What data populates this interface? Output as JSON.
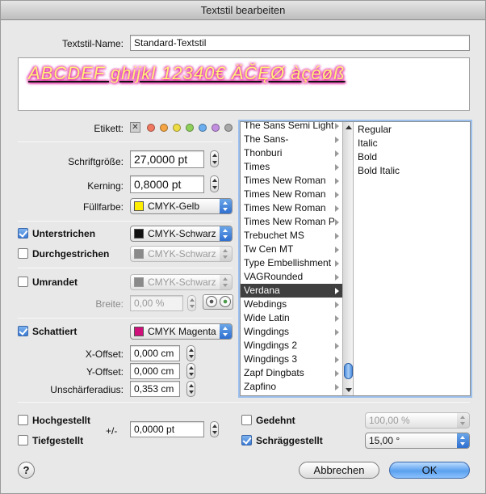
{
  "window": {
    "title": "Textstil bearbeiten"
  },
  "name": {
    "label": "Textstil-Name:",
    "value": "Standard-Textstil"
  },
  "preview": {
    "text": "ABCDEF ghijkl 12340€ ÄČĘØ àçéøß"
  },
  "labels": {
    "label": "Etikett:",
    "x": "✕",
    "colors": [
      "#f07860",
      "#f5a543",
      "#eedc45",
      "#8ed05a",
      "#6aaef0",
      "#c28ee0",
      "#a8a8a8"
    ]
  },
  "font_size": {
    "label": "Schriftgröße:",
    "value": "27,0000 pt"
  },
  "kerning": {
    "label": "Kerning:",
    "value": "0,8000 pt"
  },
  "fill": {
    "label": "Füllfarbe:",
    "value": "CMYK-Gelb",
    "swatch": "#ffee00"
  },
  "underline": {
    "label": "Unterstrichen",
    "checked": true,
    "value": "CMYK-Schwarz",
    "swatch": "#111111"
  },
  "strike": {
    "label": "Durchgestrichen",
    "checked": false,
    "value": "CMYK-Schwarz",
    "swatch": "#8a8a8a"
  },
  "outline": {
    "label": "Umrandet",
    "checked": false,
    "value": "CMYK-Schwarz",
    "swatch": "#8a8a8a"
  },
  "width": {
    "label": "Breite:",
    "value": "0,00 %"
  },
  "shadow": {
    "label": "Schattiert",
    "checked": true,
    "value": "CMYK Magenta",
    "swatch": "#d0107a"
  },
  "x_offset": {
    "label": "X-Offset:",
    "value": "0,000 cm"
  },
  "y_offset": {
    "label": "Y-Offset:",
    "value": "0,000 cm"
  },
  "blur": {
    "label": "Unschärferadius:",
    "value": "0,353 cm"
  },
  "fonts": [
    "The Sans Semi Light",
    "The Sans-",
    "Thonburi",
    "Times",
    "Times New Roman",
    "Times New Roman",
    "Times New Roman",
    "Times New Roman P",
    "Trebuchet MS",
    "Tw Cen MT",
    "Type Embellishment",
    "VAGRounded",
    "Verdana",
    "Webdings",
    "Wide Latin",
    "Wingdings",
    "Wingdings 2",
    "Wingdings 3",
    "Zapf Dingbats",
    "Zapfino"
  ],
  "selected_font": "Verdana",
  "styles": [
    "Regular",
    "Italic",
    "Bold",
    "Bold Italic"
  ],
  "superscript": {
    "label": "Hochgestellt",
    "checked": false
  },
  "subscript": {
    "label": "Tiefgestellt",
    "checked": false
  },
  "offset": {
    "label": "+/-",
    "value": "0,0000 pt"
  },
  "stretched": {
    "label": "Gedehnt",
    "checked": false,
    "value": "100,00 %"
  },
  "slanted": {
    "label": "Schräggestellt",
    "checked": true,
    "value": "15,00 °"
  },
  "buttons": {
    "help": "?",
    "cancel": "Abbrechen",
    "ok": "OK"
  }
}
